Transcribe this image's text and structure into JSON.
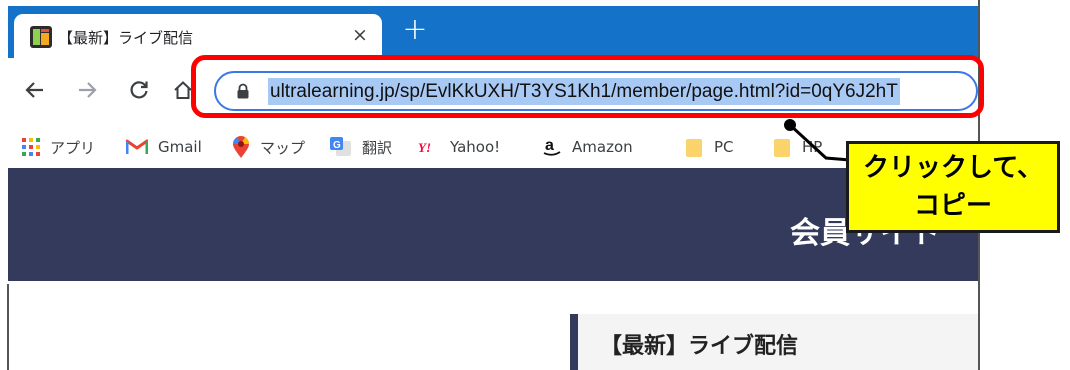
{
  "browser": {
    "tab": {
      "title": "【最新】ライブ配信",
      "close_glyph": "×"
    },
    "new_tab_glyph": "+",
    "nav": {
      "back": "←",
      "forward": "→",
      "reload": "C",
      "home": "⌂"
    },
    "address_bar": {
      "url": "ultralearning.jp/sp/EvlKkUXH/T3YS1Kh1/member/page.html?id=0qY6J2hT"
    },
    "bookmarks": [
      {
        "label": "アプリ",
        "icon": "apps-grid-icon"
      },
      {
        "label": "Gmail",
        "icon": "gmail-icon"
      },
      {
        "label": "マップ",
        "icon": "maps-pin-icon"
      },
      {
        "label": "翻訳",
        "icon": "translate-icon"
      },
      {
        "label": "Yahoo!",
        "icon": "yahoo-icon"
      },
      {
        "label": "Amazon",
        "icon": "amazon-icon"
      },
      {
        "label": "PC",
        "icon": "folder-icon"
      },
      {
        "label": "HP",
        "icon": "folder-icon"
      }
    ],
    "accent_color": "#1473c9"
  },
  "page": {
    "site_title": "会員サイト",
    "section_title": "【最新】ライブ配信",
    "banner_color": "#333a5c"
  },
  "annotation": {
    "callout_line1": "クリックして、",
    "callout_line2": "コピー",
    "highlight_color": "#ff0000",
    "callout_color": "#ffff00"
  }
}
